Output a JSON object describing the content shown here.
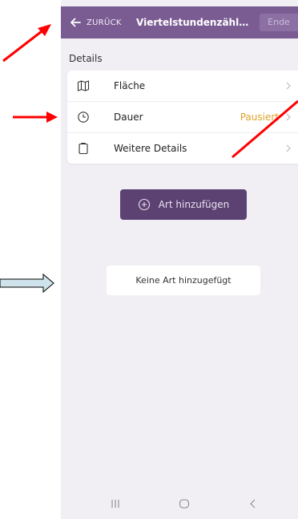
{
  "appbar": {
    "back_label": "ZURÜCK",
    "title": "Viertelstundenzählun...",
    "end_label": "Ende"
  },
  "section": {
    "label": "Details"
  },
  "details": [
    {
      "label": "Fläche",
      "icon": "map-icon",
      "status": ""
    },
    {
      "label": "Dauer",
      "icon": "clock-icon",
      "status": "Pausiert"
    },
    {
      "label": "Weitere Details",
      "icon": "clipboard-icon",
      "status": ""
    }
  ],
  "add_button": {
    "label": "Art hinzufügen",
    "icon": "plus-circle-icon"
  },
  "empty_state": {
    "text": "Keine Art hinzugefügt"
  },
  "nav": {
    "items": [
      "recent-apps-icon",
      "home-icon",
      "back-nav-icon"
    ]
  },
  "colors": {
    "appbar": "#7a5c93",
    "add_button": "#5c4272",
    "status": "#e0a229",
    "background": "#f1eff3",
    "annotation_red": "#ff0000",
    "annotation_outline_fill": "#cfe3ec"
  }
}
